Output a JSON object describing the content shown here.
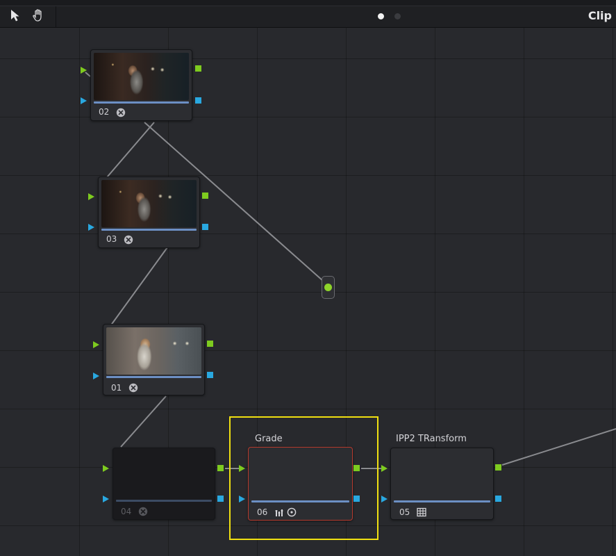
{
  "toolbar": {
    "pointer_tool": "pointer-arrow-icon",
    "hand_tool": "hand-pan-icon",
    "page_dots": [
      {
        "active": true
      },
      {
        "active": false
      }
    ],
    "mode_label": "Clip"
  },
  "nodes": [
    {
      "id": "02",
      "label": "",
      "icon": "fx-icon",
      "thumbnail": "dark-scene-woman"
    },
    {
      "id": "03",
      "label": "",
      "icon": "fx-icon",
      "thumbnail": "dark-scene-woman"
    },
    {
      "id": "01",
      "label": "",
      "icon": "fx-icon",
      "thumbnail": "bright-scene-woman"
    },
    {
      "id": "04",
      "label": "",
      "icon": "fx-icon",
      "state": "disabled"
    },
    {
      "id": "06",
      "label": "Grade",
      "icons": [
        "levels-icon",
        "circle-target-icon"
      ],
      "state": "selected"
    },
    {
      "id": "05",
      "label": "IPP2 TRansform",
      "icon": "lut-grid-icon"
    }
  ],
  "colors": {
    "rgb_input_port": "#7ecb1f",
    "key_port": "#29a8e0",
    "selection": "#f0e011",
    "active_node_border": "#b53a2e",
    "connection_line": "#8a8b8f"
  }
}
